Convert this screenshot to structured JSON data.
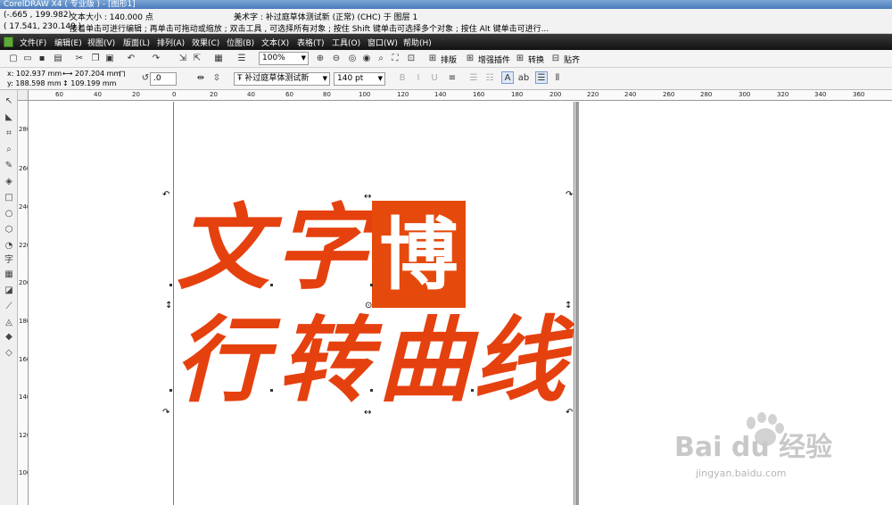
{
  "window": {
    "title": "CorelDRAW X4 ( 专业版 ) - [图形1]"
  },
  "status": {
    "cursor_coords": "(-.665 , 199.982)",
    "text_size": "文本大小 : 140.000 点",
    "object_info": "美术字 : 补过庭草体测试新 (正常) (CHC) 于 图层 1",
    "pointer_coords": "( 17.541, 230.149 )",
    "hint": "接着单击可进行编辑 ; 再单击可拖动或缩放 ; 双击工具 , 可选择所有对象 ; 按住 Shift 键单击可选择多个对象 ; 按住 Alt 键单击可进行..."
  },
  "menu": [
    "文件(F)",
    "编辑(E)",
    "视图(V)",
    "版面(L)",
    "排列(A)",
    "效果(C)",
    "位图(B)",
    "文本(X)",
    "表格(T)",
    "工具(O)",
    "窗口(W)",
    "帮助(H)"
  ],
  "toolbar": {
    "zoom_value": "100%",
    "plugin_buttons": [
      "排版",
      "增强插件",
      "转换",
      "贴齐"
    ]
  },
  "property_bar": {
    "x_label": "x:",
    "x_value": "102.937 mm",
    "y_label": "y:",
    "y_value": "188.598 mm",
    "width_value": "207.204 mm",
    "height_value": "109.199 mm",
    "rotation_value": ".0",
    "font_name": "补过庭草体测试新",
    "font_size": "140 pt"
  },
  "ruler_h": [
    "60",
    "40",
    "20",
    "0",
    "20",
    "40",
    "60",
    "80",
    "100",
    "120",
    "140",
    "160",
    "180",
    "200",
    "220",
    "240",
    "260",
    "280",
    "300",
    "320",
    "340",
    "360"
  ],
  "ruler_v": [
    "280",
    "260",
    "240",
    "220",
    "200",
    "180",
    "160",
    "140",
    "120",
    "100"
  ],
  "artwork": {
    "line1": [
      "文",
      "字"
    ],
    "seal_char": "博",
    "line2": [
      "行",
      "转",
      "曲",
      "线"
    ],
    "color": "#e5410f"
  },
  "watermark": {
    "brand": "Bai du 经验",
    "url": "jingyan.baidu.com"
  }
}
